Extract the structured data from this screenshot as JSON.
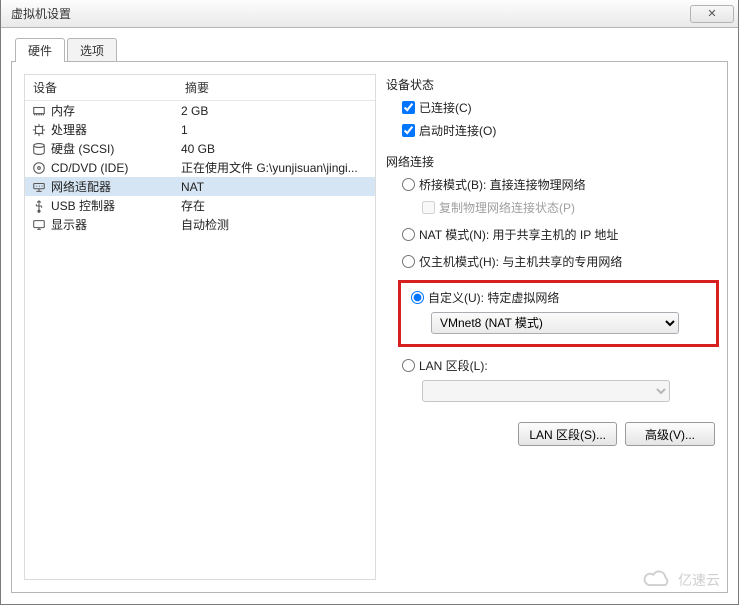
{
  "window": {
    "title": "虚拟机设置",
    "close_glyph": "✕"
  },
  "tabs": {
    "hardware": "硬件",
    "options": "选项"
  },
  "list": {
    "header_device": "设备",
    "header_summary": "摘要",
    "rows": [
      {
        "icon": "memory-icon",
        "device": "内存",
        "summary": "2 GB"
      },
      {
        "icon": "cpu-icon",
        "device": "处理器",
        "summary": "1"
      },
      {
        "icon": "disk-icon",
        "device": "硬盘 (SCSI)",
        "summary": "40 GB"
      },
      {
        "icon": "cd-icon",
        "device": "CD/DVD (IDE)",
        "summary": "正在使用文件 G:\\yunjisuan\\jingi..."
      },
      {
        "icon": "network-icon",
        "device": "网络适配器",
        "summary": "NAT"
      },
      {
        "icon": "usb-icon",
        "device": "USB 控制器",
        "summary": "存在"
      },
      {
        "icon": "display-icon",
        "device": "显示器",
        "summary": "自动检测"
      }
    ],
    "selected_index": 4
  },
  "right": {
    "status_title": "设备状态",
    "connected_label": "已连接(C)",
    "connect_at_power_on_label": "启动时连接(O)",
    "network_title": "网络连接",
    "bridged_label": "桥接模式(B): 直接连接物理网络",
    "replicate_label": "复制物理网络连接状态(P)",
    "nat_label": "NAT 模式(N): 用于共享主机的 IP 地址",
    "hostonly_label": "仅主机模式(H): 与主机共享的专用网络",
    "custom_label": "自定义(U): 特定虚拟网络",
    "custom_selected": "VMnet8 (NAT 模式)",
    "lan_segment_label": "LAN 区段(L):",
    "btn_lan_segments": "LAN 区段(S)...",
    "btn_advanced": "高级(V)..."
  },
  "watermark": {
    "text": "亿速云"
  }
}
